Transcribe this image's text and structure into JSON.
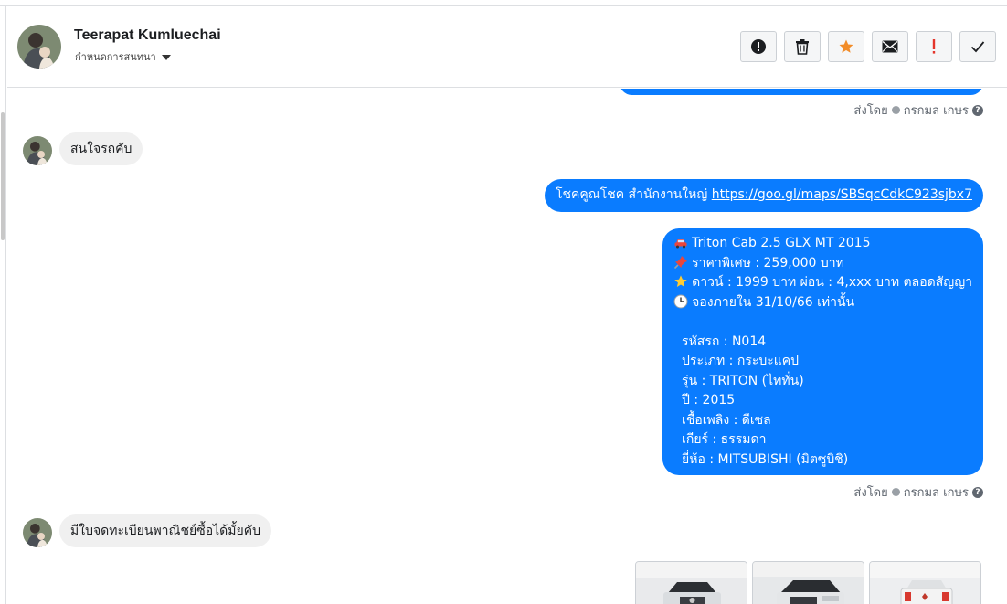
{
  "contact": {
    "name": "Teerapat Kumluechai",
    "status_dropdown": "กำหนดการสนทนา"
  },
  "toolbar": {
    "buttons": [
      {
        "icon": "report-icon",
        "label": "report"
      },
      {
        "icon": "trash-icon",
        "label": "delete"
      },
      {
        "icon": "star-icon",
        "label": "star",
        "color": "#f28c28"
      },
      {
        "icon": "envelope-icon",
        "label": "mark-unread"
      },
      {
        "icon": "exclamation-icon",
        "label": "follow-up",
        "color": "#e4352b"
      },
      {
        "icon": "checkmark-icon",
        "label": "done"
      }
    ]
  },
  "colors": {
    "accent": "#0a7cff",
    "incoming_bg": "#f0f0f0",
    "meta_text": "#606770"
  },
  "messages": {
    "sent_by_1": {
      "prefix": "ส่งโดย",
      "name": "กรกมล เกษร"
    },
    "incoming_1": "สนใจรถคับ",
    "outgoing_1": {
      "text": "โชคคูณโชค สำนักงานใหญ่ ",
      "link": "https://goo.gl/maps/SBSqcCdkC923sjbx7"
    },
    "outgoing_2": {
      "lines": [
        {
          "emoji": "car-icon",
          "text": "Triton Cab 2.5 GLX MT 2015"
        },
        {
          "emoji": "pin-icon",
          "text": "ราคาพิเศษ : 259,000 บาท"
        },
        {
          "emoji": "star-emoji-icon",
          "text": "ดาวน์ : 1999 บาท ผ่อน : 4,xxx บาท ตลอดสัญญา"
        },
        {
          "emoji": "clock-icon",
          "text": "จองภายใน 31/10/66 เท่านั้น"
        },
        {
          "emoji": "",
          "text": ""
        },
        {
          "emoji": "",
          "text": "  รหัสรถ : N014"
        },
        {
          "emoji": "",
          "text": "  ประเภท : กระบะแคป"
        },
        {
          "emoji": "",
          "text": "  รุ่น : TRITON (ไททั่น)"
        },
        {
          "emoji": "",
          "text": "  ปี : 2015"
        },
        {
          "emoji": "",
          "text": "  เชื้อเพลิง : ดีเซล"
        },
        {
          "emoji": "",
          "text": "  เกียร์ : ธรรมดา"
        },
        {
          "emoji": "",
          "text": "  ยี่ห้อ : MITSUBISHI (มิตซูบิชิ)"
        }
      ]
    },
    "sent_by_2": {
      "prefix": "ส่งโดย",
      "name": "กรกมล เกษร"
    },
    "incoming_2": "มีใบจดทะเบียนพาณิชย์ซื้อได้มั้ยคับ"
  },
  "photos": [
    "car-photo-front",
    "car-photo-front-angle",
    "car-photo-rear"
  ]
}
